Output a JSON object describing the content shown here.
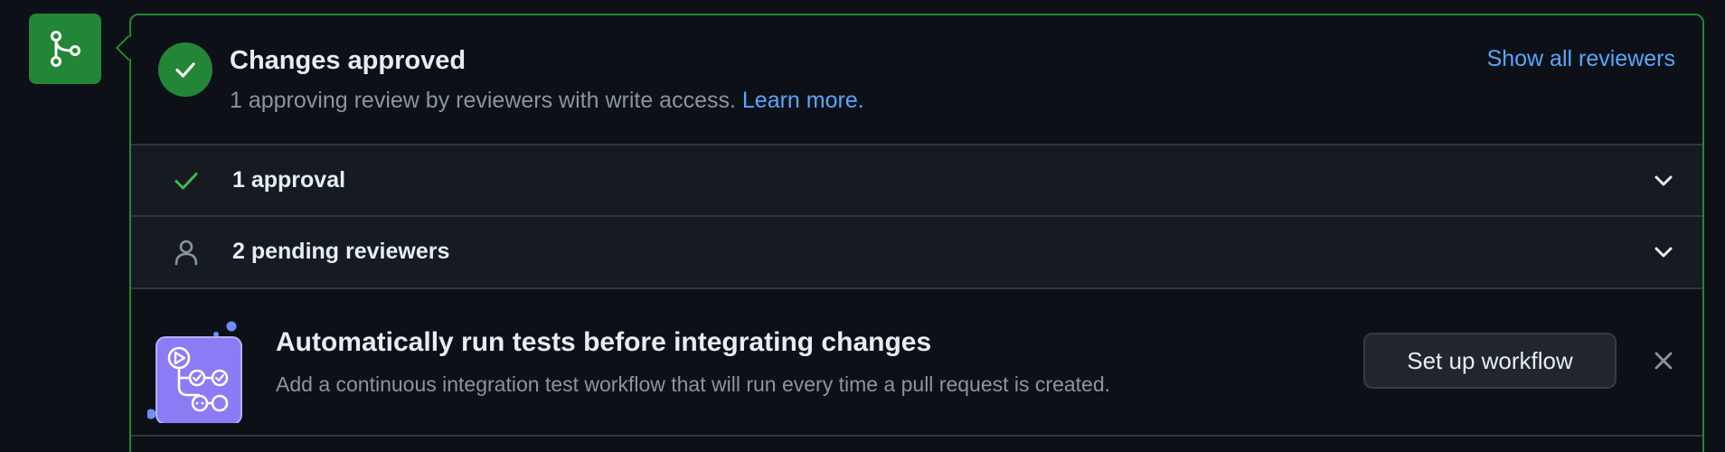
{
  "merge_icon": {
    "name": "git-merge-icon",
    "color": "#238636"
  },
  "approval": {
    "title": "Changes approved",
    "subtitle": "1 approving review by reviewers with write access.",
    "learn_more": "Learn more.",
    "show_all": "Show all reviewers"
  },
  "reviews": [
    {
      "icon": "check-icon",
      "label": "1 approval"
    },
    {
      "icon": "person-icon",
      "label": "2 pending reviewers"
    }
  ],
  "ci_prompt": {
    "illustration": "workflow-illustration",
    "title": "Automatically run tests before integrating changes",
    "subtitle": "Add a continuous integration test workflow that will run every time a pull request is created.",
    "button": "Set up workflow",
    "close_icon": "close-icon"
  },
  "colors": {
    "accent_green": "#238636",
    "link_blue": "#58a6ff",
    "background": "#0d1117",
    "row_background": "#161b22",
    "illustration_purple": "#8b7cf6"
  }
}
